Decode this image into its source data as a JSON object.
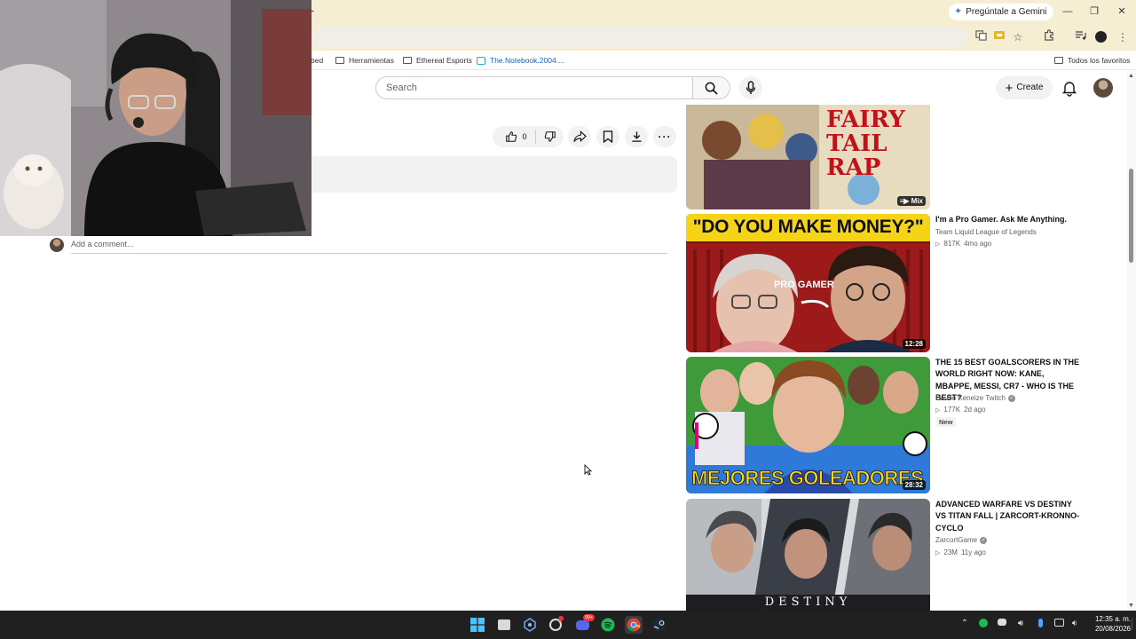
{
  "browser": {
    "new_tab_symbol": "+",
    "gemini_label": "Pregúntale a Gemini",
    "window_controls": {
      "minimize": "—",
      "maximize": "❐",
      "close": "✕"
    },
    "bookmarks": [
      {
        "label": "bed"
      },
      {
        "label": "Herramientas"
      },
      {
        "label": "Ethereal Esports"
      },
      {
        "label": "The.Notebook.2004...."
      }
    ],
    "all_bookmarks_label": "Todos los favoritos"
  },
  "youtube_header": {
    "search_placeholder": "Search",
    "create_label": "Create"
  },
  "video_actions": {
    "like_count": "0"
  },
  "comments": {
    "add_placeholder": "Add a comment..."
  },
  "sidebar": {
    "top_thumb": {
      "overlay_text": "FAIRY TAIL RAP",
      "badge": "Mix"
    },
    "videos": [
      {
        "title": "I'm a Pro Gamer. Ask Me Anything.",
        "channel": "Team Liquid League of Legends",
        "verified": false,
        "views": "817K",
        "age": "4mo ago",
        "duration": "12:28",
        "thumb_text": "\"DO YOU MAKE MONEY?\"",
        "thumb_sub": "PRO GAMER"
      },
      {
        "title": "THE 15 BEST GOALSCORERS IN THE WORLD RIGHT NOW: KANE, MBAPPE, MESSI, CR7 - WHO IS THE BEST?",
        "channel": "Davoo Xeneize Twitch",
        "verified": true,
        "views": "177K",
        "age": "2d ago",
        "badge": "New",
        "duration": "28:32",
        "thumb_text": "MEJORES GOLEADORES"
      },
      {
        "title": "ADVANCED WARFARE VS DESTINY VS TITAN FALL | ZARCORT-KRONNO-CYCLO",
        "channel": "ZarcortGame",
        "verified": true,
        "views": "23M",
        "age": "11y ago",
        "thumb_text": "DESTINY"
      }
    ]
  },
  "taskbar": {
    "time": "12:35 a. m.",
    "date": "20/08/2026",
    "discord_badge": "99+"
  },
  "colors": {
    "chrome_bg": "#f6eed3",
    "taskbar_bg": "#202020",
    "spotify": "#1db954",
    "thumb_red": "#b51b1b"
  }
}
